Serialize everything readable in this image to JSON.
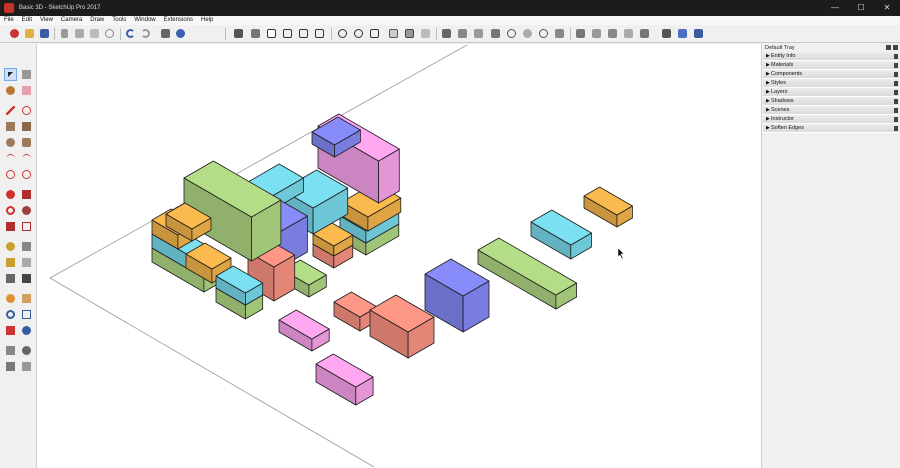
{
  "window": {
    "title": "Basic 3D - SketchUp Pro 2017",
    "controls": [
      "—",
      "☐",
      "✕"
    ]
  },
  "menu": [
    "File",
    "Edit",
    "View",
    "Camera",
    "Draw",
    "Tools",
    "Window",
    "Extensions",
    "Help"
  ],
  "tray": {
    "title": "Default Tray",
    "panels": [
      "Entity Info",
      "Materials",
      "Components",
      "Styles",
      "Layers",
      "Shadows",
      "Scenes",
      "Instructor",
      "Soften Edges"
    ]
  },
  "colors": {
    "orange": "#e8ac48",
    "cyan": "#72cfe0",
    "green": "#a7cd7e",
    "pink": "#ec9bdf",
    "blue": "#7e82e8",
    "salmon": "#ee8c7c"
  }
}
